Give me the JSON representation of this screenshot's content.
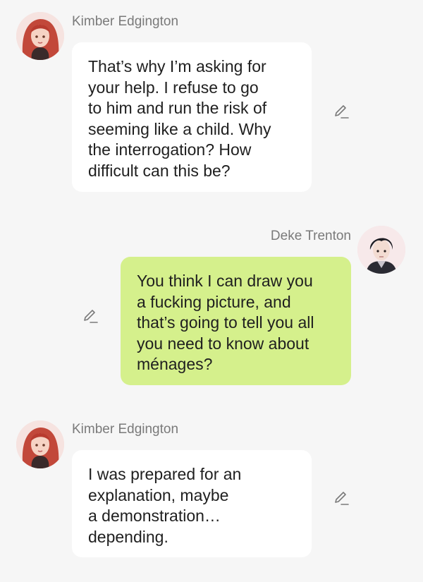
{
  "colors": {
    "background": "#f6f6f6",
    "incoming_bubble": "#ffffff",
    "outgoing_bubble": "#d5f08c",
    "name_text": "#7a7a7a",
    "message_text": "#1f1f1f",
    "edit_icon": "#7a7a7a"
  },
  "messages": [
    {
      "sender": "Kimber Edgington",
      "direction": "incoming",
      "avatar_icon": "avatar-kimber-icon",
      "lines": [
        "That’s why I’m asking for",
        "your help. I refuse to go",
        "to him and run the risk of",
        "seeming like a child. Why",
        "the interrogation? How",
        "difficult can this be?"
      ],
      "edit_icon": "edit-pencil-icon"
    },
    {
      "sender": "Deke Trenton",
      "direction": "outgoing",
      "avatar_icon": "avatar-deke-icon",
      "lines": [
        "You think I can draw you",
        "a fucking picture, and",
        "that’s going to tell you all",
        "you need to know about",
        "ménages?"
      ],
      "edit_icon": "edit-pencil-icon"
    },
    {
      "sender": "Kimber Edgington",
      "direction": "incoming",
      "avatar_icon": "avatar-kimber-icon",
      "lines": [
        "I was prepared for an",
        "explanation, maybe",
        "a demonstration…",
        "depending."
      ],
      "edit_icon": "edit-pencil-icon"
    }
  ]
}
